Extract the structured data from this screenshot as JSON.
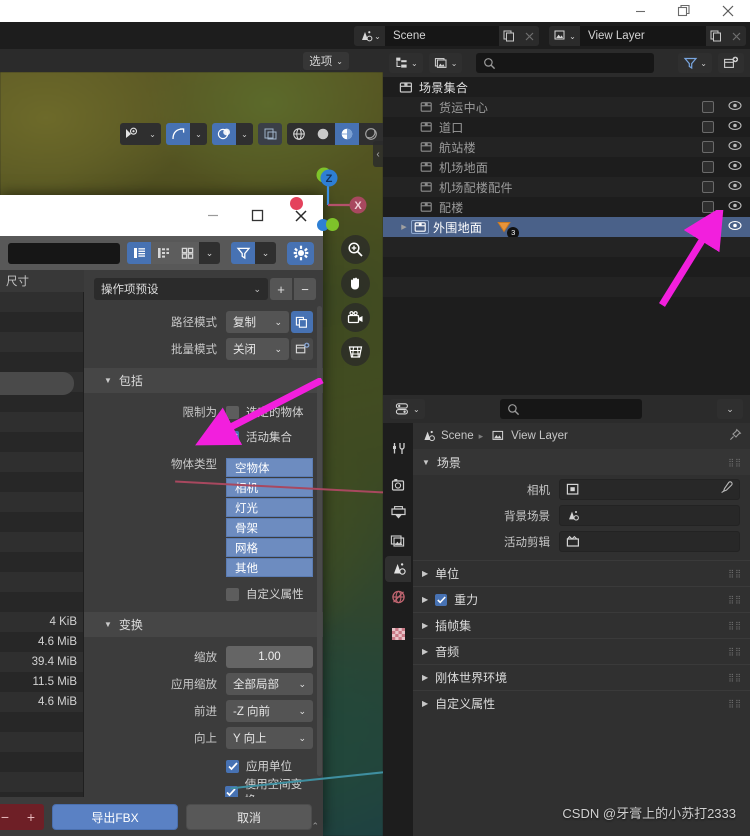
{
  "os_window": {
    "minimize": "—",
    "maximize": "❐",
    "close": "✕"
  },
  "topbar": {
    "scene_label": "Scene",
    "view_layer_label": "View Layer",
    "scene_icon": "scene-icon",
    "view_layer_icon": "image-layer-icon",
    "copy_icon": "copy-icon",
    "x_icon": "close-icon"
  },
  "viewport": {
    "options_label": "选项",
    "toolbar_icons": [
      "visibility-eye-icon",
      "chevron-down-icon",
      "gizmo-icon",
      "chevron-down-icon",
      "overlays-icon",
      "chevron-down-icon",
      "xray-toggle-icon",
      "shading-wireframe-icon",
      "shading-solid-icon",
      "shading-material-icon",
      "shading-rendered-icon",
      "chevron-down-icon"
    ],
    "side_buttons": [
      "zoom-icon",
      "pan-hand-icon",
      "camera-view-icon",
      "grid-ortho-icon"
    ],
    "gizmo_axes": [
      "Z",
      "X"
    ],
    "collapse_arrow": "‹"
  },
  "outliner": {
    "display_mode_label": "view-layer-mode-icon",
    "filter_icon": "filter-funnel-icon",
    "new_collection_icon": "new-collection-icon",
    "search_placeholder": "",
    "search_icon": "search-icon",
    "root": {
      "label": "场景集合",
      "icon": "collection-icon"
    },
    "items": [
      {
        "label": "货运中心",
        "icon": "collection-icon",
        "checked": false,
        "visible": true,
        "selected": false,
        "expandable": false,
        "modifier_count": null
      },
      {
        "label": "道口",
        "icon": "collection-icon",
        "checked": false,
        "visible": true,
        "selected": false,
        "expandable": false,
        "modifier_count": null
      },
      {
        "label": "航站楼",
        "icon": "collection-icon",
        "checked": false,
        "visible": true,
        "selected": false,
        "expandable": false,
        "modifier_count": null
      },
      {
        "label": "机场地面",
        "icon": "collection-icon",
        "checked": false,
        "visible": true,
        "selected": false,
        "expandable": false,
        "modifier_count": null
      },
      {
        "label": "机场配楼配件",
        "icon": "collection-icon",
        "checked": false,
        "visible": true,
        "selected": false,
        "expandable": false,
        "modifier_count": null
      },
      {
        "label": "配楼",
        "icon": "collection-icon",
        "checked": false,
        "visible": true,
        "selected": false,
        "expandable": false,
        "modifier_count": null
      },
      {
        "label": "外围地面",
        "icon": "collection-icon",
        "checked": true,
        "visible": true,
        "selected": true,
        "expandable": true,
        "modifier_count": "3"
      }
    ]
  },
  "properties": {
    "editor_type_icon": "properties-editor-icon",
    "search_placeholder": "",
    "search_icon": "search-icon",
    "dropdown_icon": "chevron-down-icon",
    "breadcrumb": {
      "scene": "Scene",
      "view_layer": "View Layer",
      "separator": "▸",
      "pin_icon": "pin-icon"
    },
    "tabs": [
      {
        "name": "tool",
        "icon": "tool-wrench-icon",
        "active": false
      },
      {
        "name": "render",
        "icon": "render-camera-icon",
        "active": false
      },
      {
        "name": "output",
        "icon": "output-printer-icon",
        "active": false
      },
      {
        "name": "view-layer",
        "icon": "view-layer-images-icon",
        "active": false
      },
      {
        "name": "scene",
        "icon": "scene-cone-icon",
        "active": true
      },
      {
        "name": "world",
        "icon": "world-globe-icon",
        "active": false
      },
      {
        "name": "texture",
        "icon": "texture-checker-icon",
        "active": false
      }
    ],
    "panel_scene": {
      "title": "场景",
      "rows": [
        {
          "label": "相机",
          "icon": "camera-object-icon",
          "value": "",
          "has_eyedropper": true
        },
        {
          "label": "背景场景",
          "icon": "scene-cone-icon",
          "value": "",
          "has_eyedropper": false
        },
        {
          "label": "活动剪辑",
          "icon": "movie-clip-icon",
          "value": "",
          "has_eyedropper": false
        }
      ]
    },
    "subpanels": [
      {
        "label": "单位",
        "has_checkbox": false,
        "checked": false
      },
      {
        "label": "重力",
        "has_checkbox": true,
        "checked": true
      },
      {
        "label": "插帧集",
        "has_checkbox": false,
        "checked": false
      },
      {
        "label": "音频",
        "has_checkbox": false,
        "checked": false
      },
      {
        "label": "刚体世界环境",
        "has_checkbox": false,
        "checked": false
      },
      {
        "label": "自定义属性",
        "has_checkbox": false,
        "checked": false
      }
    ]
  },
  "export_dialog": {
    "window_controls": {
      "minimize": "—",
      "maximize": "□",
      "close": "✕"
    },
    "toolbar": {
      "path_value": "",
      "view_buttons": [
        "list-vertical-icon",
        "list-detail-icon",
        "thumbnail-grid-icon",
        "chevron-down-icon"
      ],
      "filter_icon": "filter-funnel-icon",
      "filter_arrow": "chevron-down-icon",
      "settings_icon": "gear-icon"
    },
    "file_list": {
      "size_column_header": "尺寸",
      "sizes": [
        "4 KiB",
        "4.6 MiB",
        "39.4 MiB",
        "11.5 MiB",
        "4.6 MiB"
      ]
    },
    "operator_preset": {
      "label": "操作项预设",
      "add": "+",
      "remove": "−"
    },
    "options": [
      {
        "label": "路径模式",
        "value": "复制",
        "side_icon": "copy-paths-icon"
      },
      {
        "label": "批量模式",
        "value": "关闭",
        "side_icon": "new-collection-icon"
      }
    ],
    "include_section": {
      "title": "包括",
      "limit_to_label": "限制为",
      "selected_objects": {
        "label": "选定的物体",
        "checked": false
      },
      "active_collection": {
        "label": "活动集合",
        "checked": true
      },
      "object_types_label": "物体类型",
      "object_types": [
        "空物体",
        "相机",
        "灯光",
        "骨架",
        "网格",
        "其他"
      ],
      "custom_properties": {
        "label": "自定义属性",
        "checked": false
      }
    },
    "transform_section": {
      "title": "变换",
      "scale_label": "缩放",
      "scale_value": "1.00",
      "apply_scalings_label": "应用缩放",
      "apply_scalings_value": "全部局部",
      "forward_label": "前进",
      "forward_value": "-Z 向前",
      "up_label": "向上",
      "up_value": "Y 向上",
      "apply_unit": {
        "label": "应用单位",
        "checked": true
      },
      "use_space_transform": {
        "label": "使用空间变换",
        "checked": true
      }
    },
    "footer": {
      "minus": "−",
      "plus": "+",
      "export_label": "导出FBX",
      "cancel_label": "取消",
      "collapse_icon": "chevron-up-icon"
    }
  },
  "annotations": {
    "arrow_color": "#f21fdd",
    "arrow_outliner_target": "outliner-checkbox-exclude",
    "arrow_dialog_target": "active-collection-checkbox"
  },
  "watermark": {
    "text": "CSDN @牙膏上的小苏打2333"
  },
  "colors": {
    "accent_blue": "#4772b3",
    "selection_blue": "#4a6189",
    "list_blue": "#6d8cc0",
    "panel_bg": "#303030",
    "editor_bg": "#1d1d1d",
    "dialog_bg": "#3c3c3c",
    "arrow_magenta": "#f21fdd",
    "danger_red": "#6e1f26"
  }
}
